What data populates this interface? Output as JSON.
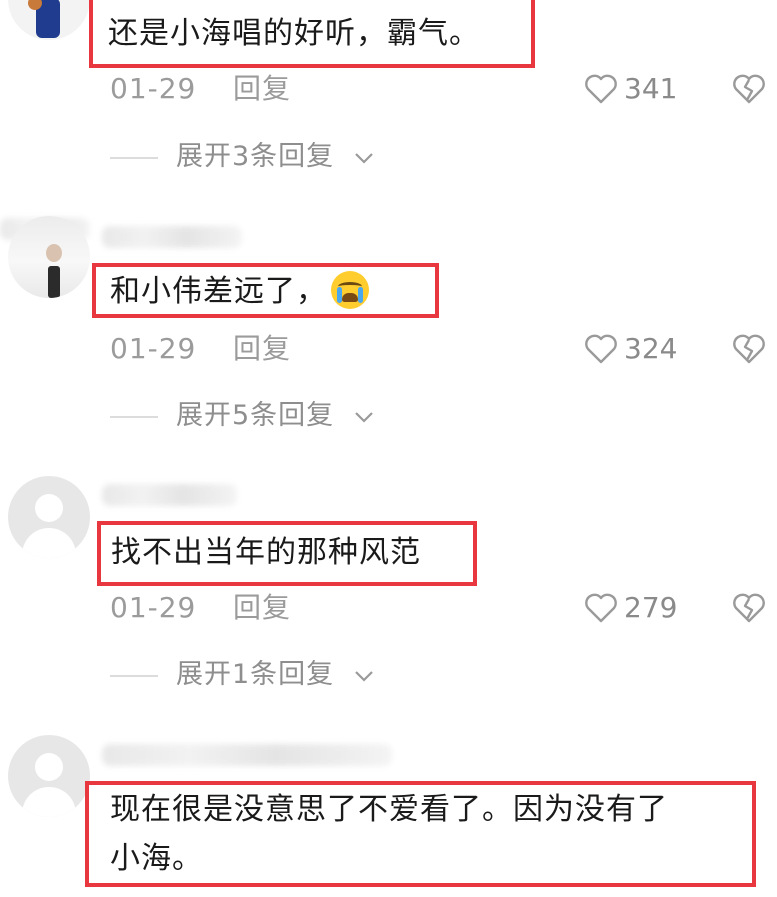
{
  "comments": [
    {
      "text": "还是小海唱的好听，霸气。",
      "date": "01-29",
      "reply": "回复",
      "likes": "341",
      "expand": "展开3条回复"
    },
    {
      "text": "和小伟差远了，",
      "emoji": "crying-face-emoji",
      "date": "01-29",
      "reply": "回复",
      "likes": "324",
      "expand": "展开5条回复"
    },
    {
      "text": "找不出当年的那种风范",
      "date": "01-29",
      "reply": "回复",
      "likes": "279",
      "expand": "展开1条回复"
    },
    {
      "text_line1": "现在很是没意思了不爱看了。因为没有了",
      "text_line2": "小海。"
    }
  ],
  "colors": {
    "highlight_border": "#e8373f",
    "meta_text": "#9b9b9b"
  },
  "icons": [
    "heart-outline-icon",
    "broken-heart-icon",
    "chevron-down-icon"
  ]
}
